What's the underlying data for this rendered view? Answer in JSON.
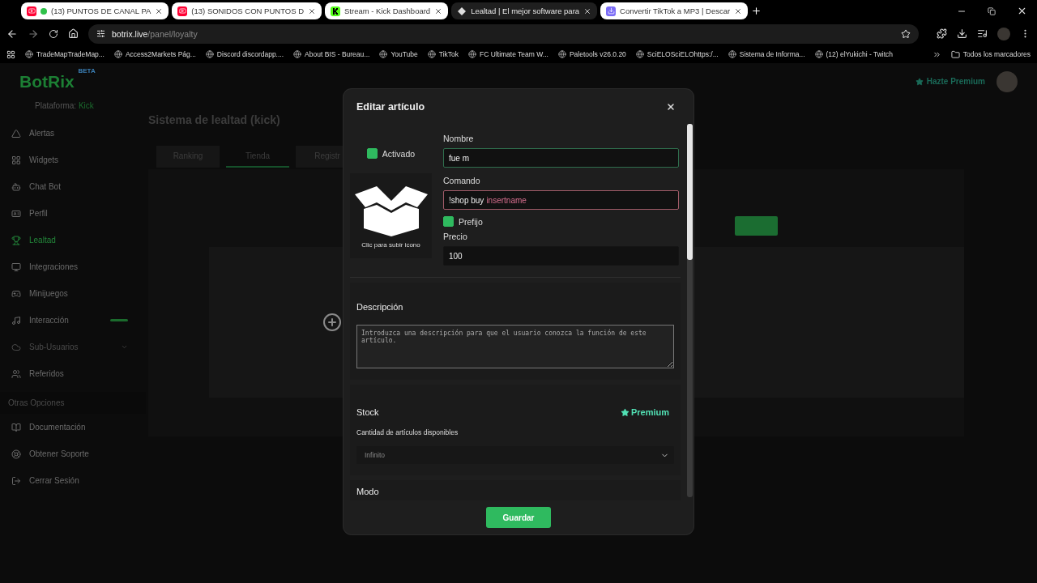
{
  "browser": {
    "tabs": [
      {
        "kind": "youtube",
        "title": "(13) PUNTOS DE CANAL PA",
        "live_dot": true,
        "selected": false
      },
      {
        "kind": "youtube",
        "title": "(13) SONIDOS CON PUNTOS D",
        "live_dot": false,
        "selected": false
      },
      {
        "kind": "kick",
        "title": "Stream - Kick Dashboard",
        "live_dot": false,
        "selected": false
      },
      {
        "kind": "botrix",
        "title": "Lealtad | El mejor software para",
        "live_dot": false,
        "selected": true
      },
      {
        "kind": "download",
        "title": "Convertir TikTok a MP3 | Descar",
        "live_dot": false,
        "selected": false
      }
    ],
    "address": {
      "host": "botrix.live",
      "path": "/panel/loyalty"
    },
    "bookmarks": [
      "TradeMapTradeMap...",
      "Access2Markets Pág...",
      "Discord discordapp....",
      "About BIS - Bureau...",
      "YouTube",
      "TikTok",
      "FC Ultimate Team W...",
      "Paletools v26.0.20",
      "SciELOSciELOhttps:/...",
      "Sistema de Informa...",
      "(12) elYukichi - Twitch"
    ],
    "all_bookmarks": "Todos los marcadores"
  },
  "app": {
    "logo": "BotRix",
    "logo_badge": "BETA",
    "premium": "Hazte Premium",
    "platform": {
      "label": "Plataforma:",
      "value": "Kick"
    },
    "nav": [
      {
        "kind": "alert",
        "label": "Alertas",
        "selected": false,
        "disabled": false,
        "badge": false,
        "caret": false
      },
      {
        "kind": "grid",
        "label": "Widgets",
        "selected": false,
        "disabled": false,
        "badge": false,
        "caret": false
      },
      {
        "kind": "bot",
        "label": "Chat Bot",
        "selected": false,
        "disabled": false,
        "badge": false,
        "caret": false
      },
      {
        "kind": "card",
        "label": "Perfil",
        "selected": false,
        "disabled": false,
        "badge": false,
        "caret": false
      },
      {
        "kind": "trophy",
        "label": "Lealtad",
        "selected": true,
        "disabled": false,
        "badge": false,
        "caret": false
      },
      {
        "kind": "monitor",
        "label": "Integraciones",
        "selected": false,
        "disabled": false,
        "badge": false,
        "caret": false
      },
      {
        "kind": "gamepad",
        "label": "Minijuegos",
        "selected": false,
        "disabled": false,
        "badge": false,
        "caret": false
      },
      {
        "kind": "music",
        "label": "Interacción",
        "selected": false,
        "disabled": false,
        "badge": true,
        "caret": false
      },
      {
        "kind": "cloud",
        "label": "Sub-Usuarios",
        "selected": false,
        "disabled": true,
        "badge": false,
        "caret": true
      },
      {
        "kind": "users",
        "label": "Referidos",
        "selected": false,
        "disabled": false,
        "badge": false,
        "caret": false
      }
    ],
    "other_heading": "Otras Opciones",
    "other_nav": [
      {
        "kind": "book",
        "label": "Documentación"
      },
      {
        "kind": "support",
        "label": "Obtener Soporte"
      },
      {
        "kind": "logout",
        "label": "Cerrar Sesión"
      }
    ],
    "page_title": "Sistema de lealtad (kick)",
    "tabs": [
      {
        "label": "Ranking",
        "selected": false
      },
      {
        "label": "Tienda",
        "selected": true
      },
      {
        "label": "Registr",
        "selected": false
      }
    ]
  },
  "dialog": {
    "title": "Editar artículo",
    "enabled": {
      "label": "Activado",
      "checked": true
    },
    "icon_hint": "Clic para subir icono",
    "name": {
      "label": "Nombre",
      "value": "fue m",
      "focused": true
    },
    "command": {
      "label": "Comando",
      "prefix": "!shop buy",
      "variable": "insertname",
      "invalid": true
    },
    "prefix_option": {
      "label": "Prefijo",
      "checked": true
    },
    "price": {
      "label": "Precio",
      "value": "100"
    },
    "description": {
      "heading": "Descripción",
      "placeholder": "Introduzca una descripción para que el usuario conozca la función de este artículo."
    },
    "stock": {
      "heading": "Stock",
      "badge": "Premium",
      "label": "Cantidad de artículos disponibles",
      "value": "Infinito"
    },
    "mode": {
      "heading": "Modo"
    },
    "save": "Guardar"
  }
}
